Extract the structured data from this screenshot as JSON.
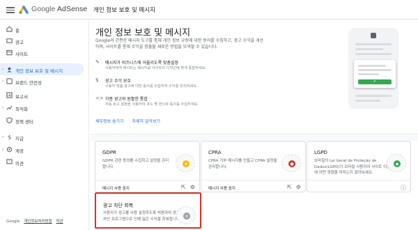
{
  "app": {
    "brand_google": "Google",
    "brand_product": "AdSense",
    "page_heading": "개인 정보 보호 및 메시지"
  },
  "sidebar": {
    "items": [
      {
        "label": "홈",
        "icon": "home-icon"
      },
      {
        "label": "광고",
        "icon": "ads-icon"
      },
      {
        "label": "사이트",
        "icon": "sites-icon"
      },
      {
        "label": "개인 정보 보호 및 메시지",
        "icon": "privacy-icon",
        "active": true
      },
      {
        "label": "브랜드 안전성",
        "icon": "brand-safety-icon"
      },
      {
        "label": "보고서",
        "icon": "reports-icon"
      },
      {
        "label": "최적화",
        "icon": "optimization-icon"
      },
      {
        "label": "정책 센터",
        "icon": "policy-center-icon"
      },
      {
        "label": "지급",
        "icon": "payments-icon"
      },
      {
        "label": "계정",
        "icon": "account-icon"
      },
      {
        "label": "의견",
        "icon": "feedback-icon"
      }
    ],
    "footer": {
      "google": "Google",
      "privacy": "개인정보처리방침",
      "terms": "약관"
    }
  },
  "main": {
    "title": "개인 정보 보호 및 메시지",
    "intro": "Google의 간편한 메시지 도구를 통해 개인 정보 규정에 대한 동의를 수집하고, 광고 수익을 개선하며, 사이트를 통해 수익을 창출할 새로운 방법을 모색할 수 있습니다.",
    "features": [
      {
        "icon": "pencil-icon",
        "title": "메시지가 비즈니스에 어울리도록 맞춤설정",
        "desc": "사용자에게 제시되는 메시지를 사이트의 디자인에 맞게 통합하세요."
      },
      {
        "icon": "dollar-icon",
        "title": "광고 수익 보호",
        "desc": "사용자 맞춤 광고에 대한 동의를 수집하여 수익을 유지하세요."
      },
      {
        "icon": "code-icon",
        "title": "각종 광고와 원활한 통합",
        "desc": "자동 광고 설정을 사용하여 코드 몇 번으로 동의를 수집하세요."
      }
    ],
    "links": {
      "hide": "세부정보 숨기기",
      "learn_more": "자세히 알아보기"
    }
  },
  "cards": [
    {
      "title": "GDPR",
      "desc": "GDPR 관련 동의를 수집하고 설정을 관리합니다.",
      "action": "메시지 사용 중지",
      "thumb_color": "#fbbc04"
    },
    {
      "title": "CPRA",
      "desc": "CPRA 거부 메시지를 만들고 CPRA 설정을 관리합니다.",
      "action": "메시지 사용 중지",
      "thumb_color": "#d93025"
    },
    {
      "title": "LGPD",
      "desc": "브라질의 Lei Geral de Proteção de Dados(LGPD)가 브라질 사용자의 사이트 이용에 어떤 영향을 미치는지 알아보세요.",
      "action": "",
      "thumb_color": "#34a853"
    },
    {
      "title": "광고 차단 회복",
      "desc": "사용자가 광고를 사용 설정하도록 허용하여 광고 차단 프로그램으로 인해 잃은 수익을 회복합니다.",
      "action": "",
      "thumb_color": "#9aa0a6"
    }
  ]
}
